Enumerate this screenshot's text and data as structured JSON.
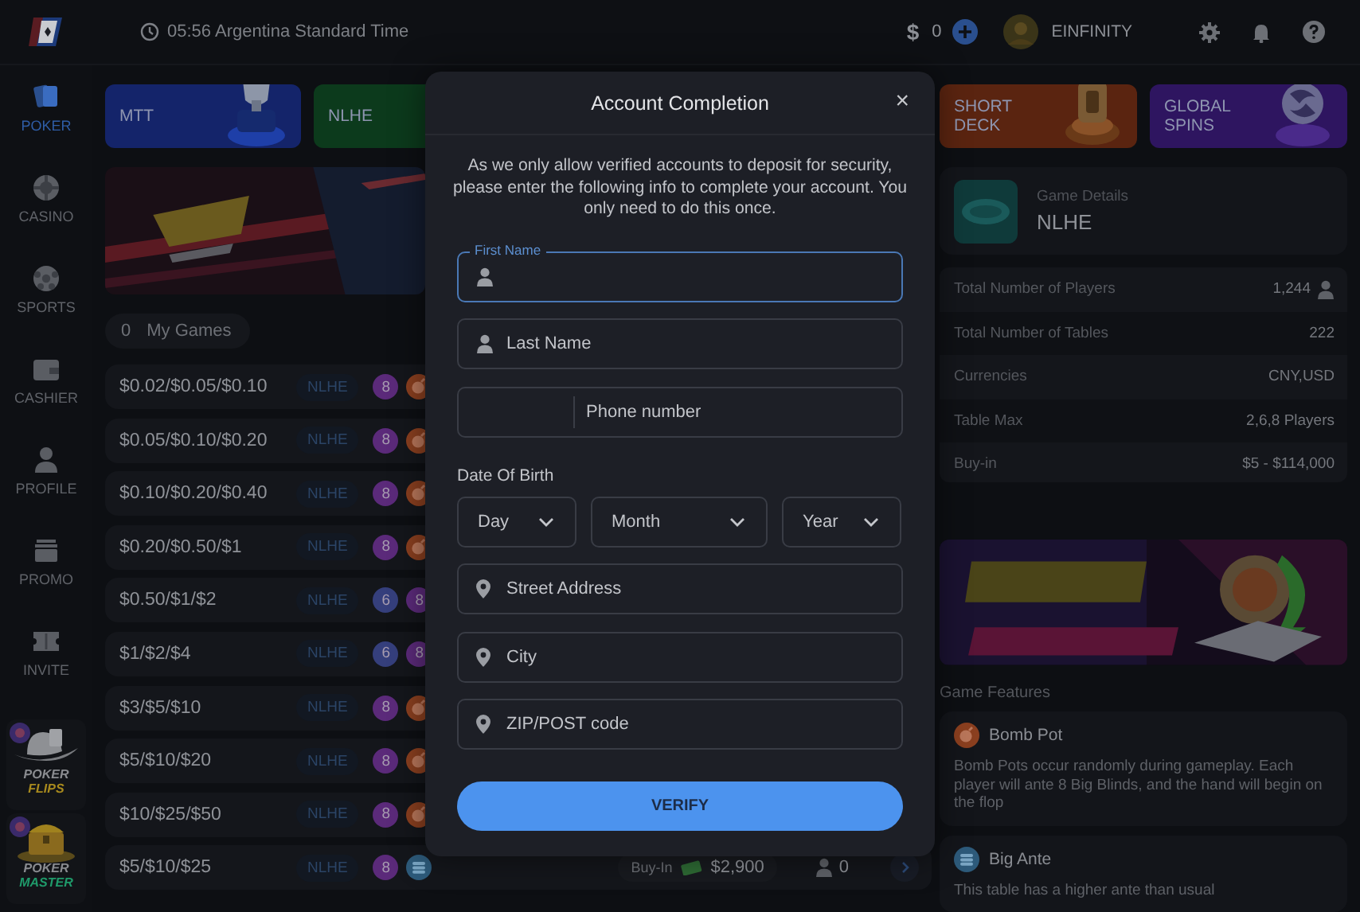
{
  "top_bar": {
    "time": "05:56 Argentina Standard Time",
    "currency_symbol": "$",
    "balance": "0",
    "username": "EINFINITY"
  },
  "sidebar": {
    "items": [
      {
        "label": "POKER",
        "selected": true
      },
      {
        "label": "CASINO",
        "selected": false
      },
      {
        "label": "SPORTS",
        "selected": false
      },
      {
        "label": "CASHIER",
        "selected": false
      },
      {
        "label": "PROFILE",
        "selected": false
      },
      {
        "label": "PROMO",
        "selected": false
      },
      {
        "label": "INVITE",
        "selected": false
      }
    ],
    "promos": [
      {
        "top": "POKER",
        "bottom": "FLIPS",
        "color": "#a88a1e"
      },
      {
        "top": "POKER",
        "bottom": "MASTER",
        "color": "#1f9a6a"
      }
    ]
  },
  "lobby": {
    "tiles": [
      {
        "kind": "mtt",
        "label": "MTT",
        "color": "#14246a"
      },
      {
        "kind": "nlhe",
        "label": "NLHE",
        "color": "#0c3a1c"
      }
    ],
    "my_games": {
      "count": "0",
      "label": "My Games"
    },
    "rows": [
      {
        "stakes": "$0.02/$0.05/$0.10",
        "game": "NLHE",
        "badges": [
          {
            "kind": "seats",
            "text": "8",
            "color": "#5b2a7a"
          },
          {
            "kind": "bomb"
          }
        ]
      },
      {
        "stakes": "$0.05/$0.10/$0.20",
        "game": "NLHE",
        "badges": [
          {
            "kind": "seats",
            "text": "8",
            "color": "#5b2a7a"
          },
          {
            "kind": "bomb"
          }
        ]
      },
      {
        "stakes": "$0.10/$0.20/$0.40",
        "game": "NLHE",
        "badges": [
          {
            "kind": "seats",
            "text": "8",
            "color": "#5b2a7a"
          },
          {
            "kind": "bomb"
          }
        ]
      },
      {
        "stakes": "$0.20/$0.50/$1",
        "game": "NLHE",
        "badges": [
          {
            "kind": "seats",
            "text": "8",
            "color": "#5b2a7a"
          },
          {
            "kind": "bomb"
          }
        ]
      },
      {
        "stakes": "$0.50/$1/$2",
        "game": "NLHE",
        "badges": [
          {
            "kind": "seats",
            "text": "6",
            "color": "#353f7c"
          },
          {
            "kind": "seats",
            "text": "8",
            "color": "#5b2a7a"
          }
        ]
      },
      {
        "stakes": "$1/$2/$4",
        "game": "NLHE",
        "badges": [
          {
            "kind": "seats",
            "text": "6",
            "color": "#353f7c"
          },
          {
            "kind": "seats",
            "text": "8",
            "color": "#5b2a7a"
          }
        ]
      },
      {
        "stakes": "$3/$5/$10",
        "game": "NLHE",
        "badges": [
          {
            "kind": "seats",
            "text": "8",
            "color": "#5b2a7a"
          },
          {
            "kind": "bomb"
          }
        ]
      },
      {
        "stakes": "$5/$10/$20",
        "game": "NLHE",
        "badges": [
          {
            "kind": "seats",
            "text": "8",
            "color": "#5b2a7a"
          },
          {
            "kind": "bomb"
          }
        ]
      },
      {
        "stakes": "$10/$25/$50",
        "game": "NLHE",
        "badges": [
          {
            "kind": "seats",
            "text": "8",
            "color": "#5b2a7a"
          },
          {
            "kind": "bomb"
          }
        ]
      },
      {
        "stakes": "$5/$10/$25",
        "game": "NLHE",
        "badges": [
          {
            "kind": "seats",
            "text": "8",
            "color": "#5b2a7a"
          },
          {
            "kind": "ante"
          }
        ],
        "buyin_label": "Buy-In",
        "buyin": "$2,900",
        "players": "0"
      }
    ]
  },
  "details": {
    "tiles": [
      {
        "kind": "short_deck",
        "label": "SHORT DECK",
        "color": "#5a2410"
      },
      {
        "kind": "spins",
        "label": "GLOBAL SPINS",
        "color": "#2e1560"
      }
    ],
    "game": {
      "caption": "Game Details",
      "name": "NLHE"
    },
    "stats": [
      {
        "kind": "players",
        "label": "Total Number of Players",
        "value": "1,244"
      },
      {
        "kind": "plain",
        "label": "Total Number of Tables",
        "value": "222"
      },
      {
        "kind": "plain",
        "label": "Currencies",
        "value": "CNY,USD"
      },
      {
        "kind": "plain",
        "label": "Table Max",
        "value": "2,6,8 Players"
      },
      {
        "kind": "plain",
        "label": "Buy-in",
        "value": "$5 - $114,000"
      }
    ],
    "features_heading": "Game Features",
    "features": [
      {
        "kind": "bomb",
        "title": "Bomb Pot",
        "text": "Bomb Pots occur randomly during gameplay. Each player will ante 8 Big Blinds, and the hand will begin on the flop"
      },
      {
        "kind": "ante",
        "title": "Big Ante",
        "text": "This table has a higher ante than usual"
      }
    ]
  },
  "modal": {
    "title": "Account Completion",
    "close": "×",
    "description": "As we only allow verified accounts to deposit for security, please enter the following info to complete your account. You only need to do this once.",
    "fields_top": [
      {
        "kind": "name",
        "label": "First Name",
        "focused": true
      },
      {
        "kind": "name",
        "placeholder": "Last Name",
        "focused": false
      },
      {
        "kind": "phone",
        "placeholder": "Phone number",
        "focused": false
      }
    ],
    "date_of_birth": {
      "label": "Date Of Birth",
      "selects": [
        {
          "placeholder": "Day"
        },
        {
          "placeholder": "Month"
        },
        {
          "placeholder": "Year"
        }
      ]
    },
    "fields_bottom": [
      {
        "kind": "address",
        "placeholder": "Street Address",
        "focused": false
      },
      {
        "kind": "address",
        "placeholder": "City",
        "focused": false
      },
      {
        "kind": "address",
        "placeholder": "ZIP/POST code",
        "focused": false
      }
    ],
    "button": "VERIFY"
  }
}
